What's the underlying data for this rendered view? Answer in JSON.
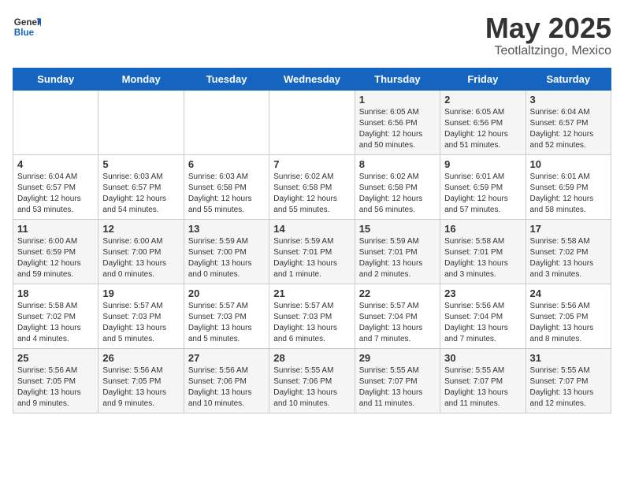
{
  "header": {
    "logo_general": "General",
    "logo_blue": "Blue",
    "title": "May 2025",
    "subtitle": "Teotlaltzingo, Mexico"
  },
  "weekdays": [
    "Sunday",
    "Monday",
    "Tuesday",
    "Wednesday",
    "Thursday",
    "Friday",
    "Saturday"
  ],
  "weeks": [
    [
      {
        "day": "",
        "info": ""
      },
      {
        "day": "",
        "info": ""
      },
      {
        "day": "",
        "info": ""
      },
      {
        "day": "",
        "info": ""
      },
      {
        "day": "1",
        "info": "Sunrise: 6:05 AM\nSunset: 6:56 PM\nDaylight: 12 hours\nand 50 minutes."
      },
      {
        "day": "2",
        "info": "Sunrise: 6:05 AM\nSunset: 6:56 PM\nDaylight: 12 hours\nand 51 minutes."
      },
      {
        "day": "3",
        "info": "Sunrise: 6:04 AM\nSunset: 6:57 PM\nDaylight: 12 hours\nand 52 minutes."
      }
    ],
    [
      {
        "day": "4",
        "info": "Sunrise: 6:04 AM\nSunset: 6:57 PM\nDaylight: 12 hours\nand 53 minutes."
      },
      {
        "day": "5",
        "info": "Sunrise: 6:03 AM\nSunset: 6:57 PM\nDaylight: 12 hours\nand 54 minutes."
      },
      {
        "day": "6",
        "info": "Sunrise: 6:03 AM\nSunset: 6:58 PM\nDaylight: 12 hours\nand 55 minutes."
      },
      {
        "day": "7",
        "info": "Sunrise: 6:02 AM\nSunset: 6:58 PM\nDaylight: 12 hours\nand 55 minutes."
      },
      {
        "day": "8",
        "info": "Sunrise: 6:02 AM\nSunset: 6:58 PM\nDaylight: 12 hours\nand 56 minutes."
      },
      {
        "day": "9",
        "info": "Sunrise: 6:01 AM\nSunset: 6:59 PM\nDaylight: 12 hours\nand 57 minutes."
      },
      {
        "day": "10",
        "info": "Sunrise: 6:01 AM\nSunset: 6:59 PM\nDaylight: 12 hours\nand 58 minutes."
      }
    ],
    [
      {
        "day": "11",
        "info": "Sunrise: 6:00 AM\nSunset: 6:59 PM\nDaylight: 12 hours\nand 59 minutes."
      },
      {
        "day": "12",
        "info": "Sunrise: 6:00 AM\nSunset: 7:00 PM\nDaylight: 13 hours\nand 0 minutes."
      },
      {
        "day": "13",
        "info": "Sunrise: 5:59 AM\nSunset: 7:00 PM\nDaylight: 13 hours\nand 0 minutes."
      },
      {
        "day": "14",
        "info": "Sunrise: 5:59 AM\nSunset: 7:01 PM\nDaylight: 13 hours\nand 1 minute."
      },
      {
        "day": "15",
        "info": "Sunrise: 5:59 AM\nSunset: 7:01 PM\nDaylight: 13 hours\nand 2 minutes."
      },
      {
        "day": "16",
        "info": "Sunrise: 5:58 AM\nSunset: 7:01 PM\nDaylight: 13 hours\nand 3 minutes."
      },
      {
        "day": "17",
        "info": "Sunrise: 5:58 AM\nSunset: 7:02 PM\nDaylight: 13 hours\nand 3 minutes."
      }
    ],
    [
      {
        "day": "18",
        "info": "Sunrise: 5:58 AM\nSunset: 7:02 PM\nDaylight: 13 hours\nand 4 minutes."
      },
      {
        "day": "19",
        "info": "Sunrise: 5:57 AM\nSunset: 7:03 PM\nDaylight: 13 hours\nand 5 minutes."
      },
      {
        "day": "20",
        "info": "Sunrise: 5:57 AM\nSunset: 7:03 PM\nDaylight: 13 hours\nand 5 minutes."
      },
      {
        "day": "21",
        "info": "Sunrise: 5:57 AM\nSunset: 7:03 PM\nDaylight: 13 hours\nand 6 minutes."
      },
      {
        "day": "22",
        "info": "Sunrise: 5:57 AM\nSunset: 7:04 PM\nDaylight: 13 hours\nand 7 minutes."
      },
      {
        "day": "23",
        "info": "Sunrise: 5:56 AM\nSunset: 7:04 PM\nDaylight: 13 hours\nand 7 minutes."
      },
      {
        "day": "24",
        "info": "Sunrise: 5:56 AM\nSunset: 7:05 PM\nDaylight: 13 hours\nand 8 minutes."
      }
    ],
    [
      {
        "day": "25",
        "info": "Sunrise: 5:56 AM\nSunset: 7:05 PM\nDaylight: 13 hours\nand 9 minutes."
      },
      {
        "day": "26",
        "info": "Sunrise: 5:56 AM\nSunset: 7:05 PM\nDaylight: 13 hours\nand 9 minutes."
      },
      {
        "day": "27",
        "info": "Sunrise: 5:56 AM\nSunset: 7:06 PM\nDaylight: 13 hours\nand 10 minutes."
      },
      {
        "day": "28",
        "info": "Sunrise: 5:55 AM\nSunset: 7:06 PM\nDaylight: 13 hours\nand 10 minutes."
      },
      {
        "day": "29",
        "info": "Sunrise: 5:55 AM\nSunset: 7:07 PM\nDaylight: 13 hours\nand 11 minutes."
      },
      {
        "day": "30",
        "info": "Sunrise: 5:55 AM\nSunset: 7:07 PM\nDaylight: 13 hours\nand 11 minutes."
      },
      {
        "day": "31",
        "info": "Sunrise: 5:55 AM\nSunset: 7:07 PM\nDaylight: 13 hours\nand 12 minutes."
      }
    ]
  ]
}
